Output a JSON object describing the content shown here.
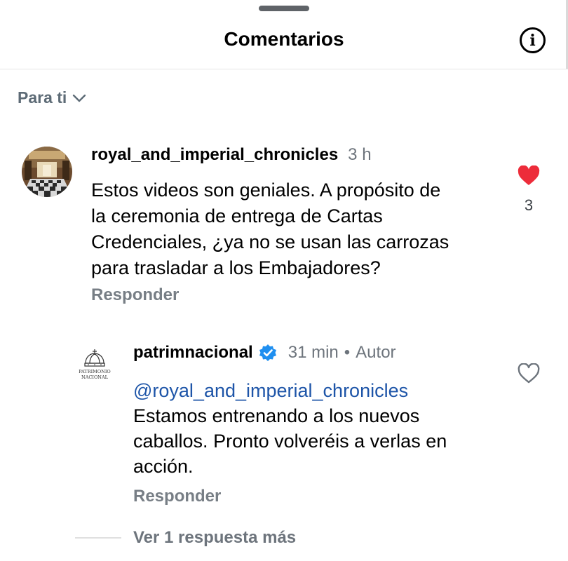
{
  "header": {
    "title": "Comentarios",
    "info_icon": "info-icon"
  },
  "filter": {
    "label": "Para ti",
    "icon": "chevron-down-icon"
  },
  "comments": [
    {
      "username": "royal_and_imperial_chronicles",
      "time": "3 h",
      "text": "Estos videos son geniales. A propósito de\nla ceremonia de entrega de Cartas\nCredenciales, ¿ya no se usan las carrozas\npara trasladar a los Embajadores?",
      "reply_label": "Responder",
      "liked": true,
      "like_count": "3",
      "like_color": "#ed2c3a"
    }
  ],
  "reply": {
    "username": "patrimnacional",
    "verified": true,
    "verified_color": "#1f8ff0",
    "time": "31 min",
    "separator": "•",
    "author_badge": "Autor",
    "mention": "@royal_and_imperial_chronicles",
    "text": "Estamos entrenando a los nuevos\ncaballos. Pronto volveréis a verlas en\nacción.",
    "reply_label": "Responder",
    "logo_text": [
      "PATRIMONIO",
      "NACIONAL"
    ]
  },
  "more_replies": "Ver 1 respuesta más"
}
